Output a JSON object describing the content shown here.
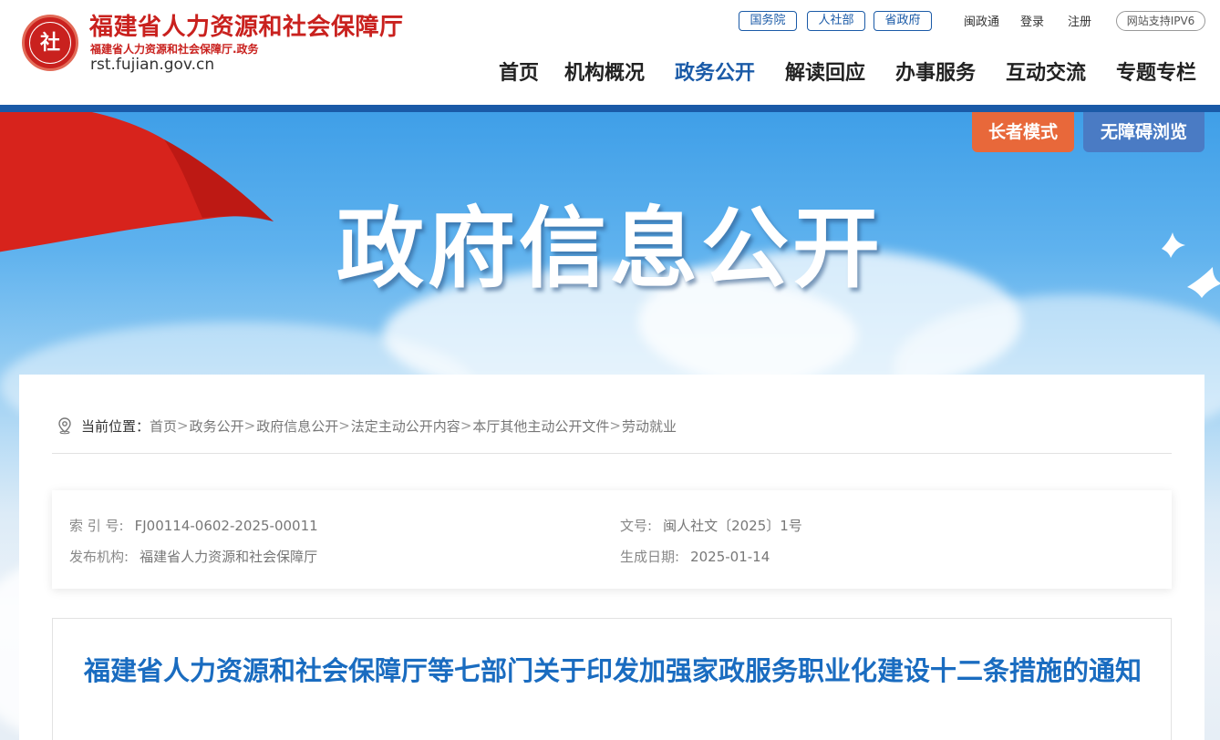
{
  "header": {
    "title": "福建省人力资源和社会保障厅",
    "subtitle": "福建省人力资源和社会保障厅.政务",
    "domain": "rst.fujian.gov.cn",
    "seal_glyph": "社",
    "quick_links": [
      "国务院",
      "人社部",
      "省政府"
    ],
    "top_links": [
      "闽政通",
      "登录",
      "注册"
    ],
    "ipv6": "网站支持IPV6",
    "nav": [
      "首页",
      "机构概况",
      "政务公开",
      "解读回应",
      "办事服务",
      "互动交流",
      "专题专栏"
    ],
    "active_nav": "政务公开",
    "accent_color": "#1a5aa7",
    "brand_red": "#c9211e"
  },
  "banner": {
    "title": "政府信息公开",
    "elder_mode": "长者模式",
    "accessible": "无障碍浏览",
    "elder_color": "#e8683a",
    "access_color": "#4a7bc4"
  },
  "breadcrumb": {
    "lead": "当前位置：",
    "items": [
      "首页",
      "政务公开",
      "政府信息公开",
      "法定主动公开内容",
      "本厅其他主动公开文件",
      "劳动就业"
    ],
    "separator": ">"
  },
  "meta": {
    "index_label": "索 引 号:",
    "index_value": "FJ00114-0602-2025-00011",
    "doc_no_label": "文号:",
    "doc_no_value": "闽人社文〔2025〕1号",
    "publisher_label": "发布机构:",
    "publisher_value": "福建省人力资源和社会保障厅",
    "date_label": "生成日期:",
    "date_value": "2025-01-14"
  },
  "document": {
    "title": "福建省人力资源和社会保障厅等七部门关于印发加强家政服务职业化建设十二条措施的通知",
    "title_color": "#1a6cc0"
  }
}
